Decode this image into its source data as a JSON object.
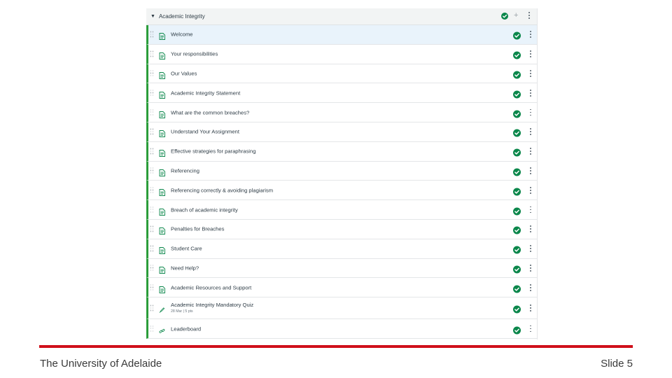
{
  "module": {
    "title": "Academic Integrity",
    "items": [
      {
        "label": "Welcome",
        "type": "page",
        "active": true
      },
      {
        "label": "Your responsibilities",
        "type": "page"
      },
      {
        "label": "Our Values",
        "type": "page"
      },
      {
        "label": "Academic Integrity Statement",
        "type": "page"
      },
      {
        "label": "What are the common breaches?",
        "type": "page"
      },
      {
        "label": "Understand Your Assignment",
        "type": "page"
      },
      {
        "label": "Effective strategies for paraphrasing",
        "type": "page"
      },
      {
        "label": "Referencing",
        "type": "page"
      },
      {
        "label": "Referencing correctly & avoiding plagiarism",
        "type": "page"
      },
      {
        "label": "Breach of academic integrity",
        "type": "page"
      },
      {
        "label": "Penalties for Breaches",
        "type": "page"
      },
      {
        "label": "Student Care",
        "type": "page"
      },
      {
        "label": "Need Help?",
        "type": "page"
      },
      {
        "label": "Academic Resources and Support",
        "type": "page"
      },
      {
        "label": "Academic Integrity Mandatory Quiz",
        "type": "quiz",
        "meta": "28 Mar | 5 pts"
      },
      {
        "label": "Leaderboard",
        "type": "link"
      }
    ]
  },
  "footer": {
    "left": "The University of Adelaide",
    "right": "Slide 5"
  },
  "colors": {
    "published_green": "#0b874b",
    "accent_red": "#d0101b",
    "module_bar_green": "#2b9d3a"
  },
  "icons": {
    "module_collapse": "caret-down-icon",
    "published": "check-circle-icon",
    "add": "plus-icon",
    "options": "kebab-icon",
    "drag": "drag-handle-icon",
    "page": "document-icon",
    "quiz": "rocket-icon",
    "link": "link-icon"
  }
}
